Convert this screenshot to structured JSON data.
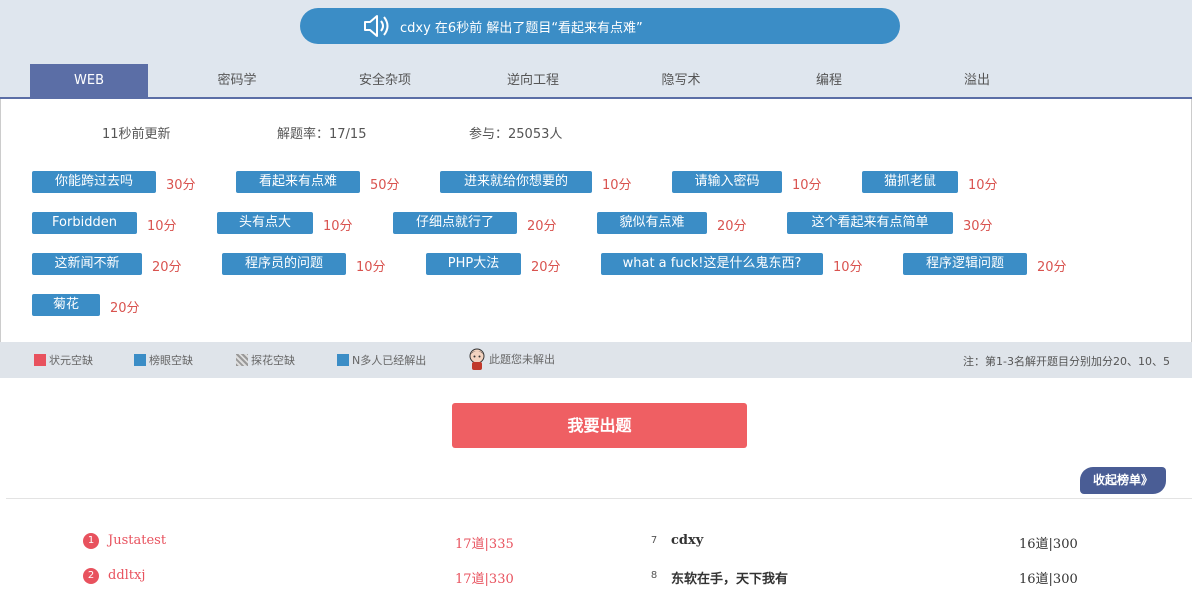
{
  "notice": {
    "text": "cdxy 在6秒前 解出了题目“看起来有点难”"
  },
  "tabs": [
    "WEB",
    "密码学",
    "安全杂项",
    "逆向工程",
    "隐写术",
    "编程",
    "溢出"
  ],
  "stats": {
    "updated": "11秒前更新",
    "solve_rate": "解题率：17/15",
    "participants": "参与：25053人"
  },
  "challenges": [
    {
      "name": "你能跨过去吗",
      "points": "30分"
    },
    {
      "name": "看起来有点难",
      "points": "50分"
    },
    {
      "name": "进来就给你想要的",
      "points": "10分"
    },
    {
      "name": "请输入密码",
      "points": "10分"
    },
    {
      "name": "猫抓老鼠",
      "points": "10分"
    },
    {
      "name": "Forbidden",
      "points": "10分"
    },
    {
      "name": "头有点大",
      "points": "10分"
    },
    {
      "name": "仔细点就行了",
      "points": "20分"
    },
    {
      "name": "貌似有点难",
      "points": "20分"
    },
    {
      "name": "这个看起来有点简单",
      "points": "30分"
    },
    {
      "name": "这新闻不新",
      "points": "20分"
    },
    {
      "name": "程序员的问题",
      "points": "10分"
    },
    {
      "name": "PHP大法",
      "points": "20分"
    },
    {
      "name": "what a fuck!这是什么鬼东西?",
      "points": "10分"
    },
    {
      "name": "程序逻辑问题",
      "points": "20分"
    },
    {
      "name": "菊花",
      "points": "20分"
    }
  ],
  "legend": {
    "items": [
      "状元空缺",
      "榜眼空缺",
      "探花空缺",
      "N多人已经解出",
      "此题您未解出"
    ],
    "note": "注：第1-3名解开题目分别加分20、10、5",
    "colors": {
      "red": "#e8525e",
      "blue": "#3b8dc6",
      "pattern": "#a9a9a9",
      "nblue": "#3b8dc6"
    }
  },
  "submit_label": "我要出题",
  "collapse_label": "收起榜单》",
  "ranking": [
    {
      "rank": "1",
      "name": "Justatest",
      "score": "17道|335"
    },
    {
      "rank": "2",
      "name": "ddltxj",
      "score": "17道|330"
    },
    {
      "rank": "7",
      "name": "cdxy",
      "score": "16道|300"
    },
    {
      "rank": "8",
      "name": "东软在手，天下我有",
      "score": "16道|300"
    }
  ]
}
